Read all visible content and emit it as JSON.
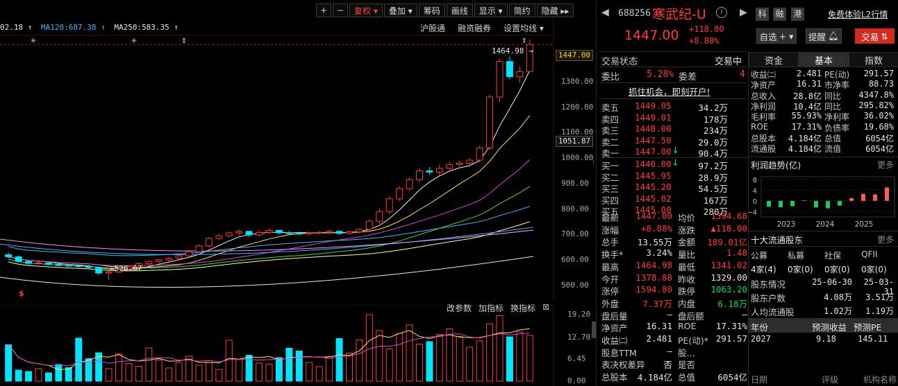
{
  "toolbar": {
    "buttons": [
      "+",
      "−",
      "复权 ▾",
      "叠加 ▾",
      "筹码",
      "画线",
      "显示 ▾",
      "简约",
      "隐藏 ▸▸"
    ]
  },
  "ma_legend": {
    "items": [
      "02.18 ↑",
      "MA120:687.38 ↑",
      "MA250:583.35 ↑"
    ]
  },
  "top_links": [
    "沪股通",
    "融资融券",
    "设置均线 ▾"
  ],
  "price_axis": [
    "1400.00",
    "1300.00",
    "1200.00",
    "1100.00",
    "1000.00",
    "900.00",
    "800.00",
    "700.00",
    "600.00",
    "500.00"
  ],
  "price_tags": {
    "current": "1447.00",
    "cursor": "1051.87",
    "high_label": "1464.98",
    "low_label": "520.67"
  },
  "vol_axis": [
    "19.20",
    "12.70",
    "6.45",
    "0.00"
  ],
  "vol_tools": [
    "改参数",
    "加指标",
    "换指标",
    "⊠"
  ],
  "stock": {
    "code": "688256",
    "name": "寒武纪-U",
    "price": "1447.00",
    "change": "+118.00",
    "change_pct": "+8.88%",
    "tags": [
      "科",
      "融",
      "港"
    ],
    "promo": "免费体验L2行情"
  },
  "actions": {
    "watch": "自选",
    "alert": "提醒",
    "trade": "交易"
  },
  "status": {
    "label": "交易状态",
    "value": "交易中"
  },
  "ratio": {
    "label": "委比",
    "value": "5.28%",
    "diff_label": "委差",
    "diff_value": "4"
  },
  "banner": "抓住机会，即刻开户!",
  "sell": [
    {
      "l": "卖五",
      "p": "1449.05",
      "v": "34.2万"
    },
    {
      "l": "卖四",
      "p": "1449.01",
      "v": "178万"
    },
    {
      "l": "卖三",
      "p": "1448.00",
      "v": "234万"
    },
    {
      "l": "卖二",
      "p": "1447.50",
      "v": "29.0万"
    },
    {
      "l": "卖一",
      "p": "1447.00",
      "v": "90.4万"
    }
  ],
  "buy": [
    {
      "l": "买一",
      "p": "1446.00",
      "v": "97.2万"
    },
    {
      "l": "买二",
      "p": "1445.95",
      "v": "28.9万"
    },
    {
      "l": "买三",
      "p": "1445.20",
      "v": "54.5万"
    },
    {
      "l": "买四",
      "p": "1445.02",
      "v": "167万"
    },
    {
      "l": "买五",
      "p": "1445.00",
      "v": "280万"
    }
  ],
  "quote": [
    [
      "最新",
      "1447.00",
      "均价",
      "1394.68"
    ],
    [
      "涨幅",
      "+8.88%",
      "涨跌",
      "▲118.00"
    ],
    [
      "总手",
      "13.55万",
      "金额",
      "189.01亿"
    ],
    [
      "换手*",
      "3.24%",
      "量比",
      "1.48"
    ],
    [
      "最高",
      "1464.98",
      "最低",
      "1341.02"
    ],
    [
      "今开",
      "1378.88",
      "昨收",
      "1329.00"
    ],
    [
      "涨停",
      "1594.80",
      "跌停",
      "1063.20"
    ],
    [
      "外盘",
      "7.37万",
      "内盘",
      "6.18万"
    ],
    [
      "盘后量",
      "—",
      "盘后额",
      "—"
    ],
    [
      "净资产",
      "16.31",
      "ROE",
      "17.31%"
    ],
    [
      "收益㈡",
      "2.481",
      "PE(动)*",
      "291.57"
    ],
    [
      "股息TTM",
      "—",
      "股…",
      ""
    ],
    [
      "表决权差异",
      "否",
      "是否",
      ""
    ],
    [
      "总股本",
      "4.184亿",
      "总值",
      "6054亿"
    ]
  ],
  "tabs": [
    "资金",
    "基本",
    "指数"
  ],
  "fund": [
    [
      "收益㈡",
      "2.481",
      "PE(动)",
      "291.57"
    ],
    [
      "净资产",
      "16.31",
      "市净率",
      "88.73"
    ],
    [
      "总收入",
      "28.8亿",
      "同比",
      "4347.8%"
    ],
    [
      "净利润",
      "10.4亿",
      "同比",
      "295.82%"
    ],
    [
      "毛利率",
      "55.93%",
      "净利率",
      "36.02%"
    ],
    [
      "ROE",
      "17.31%",
      "负债率",
      "19.68%"
    ],
    [
      "总股本",
      "4.184亿",
      "总值",
      "6054亿"
    ],
    [
      "流通股",
      "4.184亿",
      "流值",
      "6054亿"
    ]
  ],
  "profit": {
    "title": "利润趋势(亿)",
    "more": "更多",
    "yticks": [
      "8",
      "4",
      "0",
      "−4"
    ],
    "years": [
      "2023",
      "2024",
      "2025"
    ]
  },
  "holders": {
    "title": "十大流通股东",
    "more": "更多",
    "types": [
      "公募",
      "私募",
      "社保",
      "QFII"
    ],
    "counts": [
      "4家(4)",
      "0家(0)",
      "0家(0)",
      "0家(0)"
    ],
    "rows": [
      [
        "股东情况",
        "25-06-30",
        "25-03-31"
      ],
      [
        "股东户数",
        "4.08万",
        "3.51万"
      ],
      [
        "人均流通股",
        "1.02万",
        "1.19万"
      ]
    ]
  },
  "forecast": {
    "headers": [
      "年份",
      "预测收益",
      "预测PE"
    ],
    "rows": [
      [
        "2027",
        "9.18",
        "145.11"
      ]
    ],
    "footer": [
      "日期",
      "评级",
      "机构名称"
    ]
  },
  "chart_data": {
    "type": "candlestick",
    "ylim": [
      450,
      1480
    ],
    "candles": [
      [
        620,
        628,
        605,
        612
      ],
      [
        612,
        618,
        588,
        594
      ],
      [
        594,
        600,
        578,
        586
      ],
      [
        586,
        592,
        580,
        588
      ],
      [
        588,
        594,
        578,
        582
      ],
      [
        582,
        588,
        574,
        578
      ],
      [
        578,
        584,
        572,
        576
      ],
      [
        576,
        582,
        570,
        574
      ],
      [
        574,
        580,
        566,
        570
      ],
      [
        570,
        576,
        540,
        548
      ],
      [
        548,
        558,
        521,
        552
      ],
      [
        552,
        568,
        548,
        564
      ],
      [
        564,
        578,
        556,
        572
      ],
      [
        572,
        590,
        566,
        585
      ],
      [
        585,
        598,
        578,
        594
      ],
      [
        594,
        604,
        588,
        600
      ],
      [
        600,
        612,
        594,
        606
      ],
      [
        606,
        620,
        600,
        616
      ],
      [
        616,
        640,
        610,
        632
      ],
      [
        632,
        660,
        628,
        655
      ],
      [
        655,
        690,
        648,
        684
      ],
      [
        684,
        702,
        676,
        695
      ],
      [
        695,
        712,
        688,
        706
      ],
      [
        706,
        720,
        694,
        712
      ],
      [
        712,
        714,
        690,
        698
      ],
      [
        698,
        716,
        690,
        708
      ],
      [
        708,
        722,
        700,
        716
      ],
      [
        716,
        718,
        700,
        706
      ],
      [
        706,
        714,
        700,
        704
      ],
      [
        704,
        710,
        698,
        702
      ],
      [
        702,
        712,
        696,
        706
      ],
      [
        706,
        714,
        700,
        708
      ],
      [
        708,
        720,
        700,
        712
      ],
      [
        712,
        716,
        698,
        704
      ],
      [
        704,
        716,
        698,
        710
      ],
      [
        710,
        724,
        706,
        720
      ],
      [
        720,
        760,
        716,
        752
      ],
      [
        752,
        800,
        740,
        790
      ],
      [
        790,
        850,
        780,
        840
      ],
      [
        840,
        890,
        830,
        880
      ],
      [
        880,
        925,
        870,
        915
      ],
      [
        915,
        960,
        905,
        950
      ],
      [
        950,
        965,
        935,
        945
      ],
      [
        945,
        975,
        930,
        960
      ],
      [
        960,
        985,
        950,
        975
      ],
      [
        975,
        990,
        965,
        980
      ],
      [
        980,
        1000,
        965,
        992
      ],
      [
        992,
        1050,
        985,
        1040
      ],
      [
        1040,
        1250,
        1030,
        1240
      ],
      [
        1240,
        1390,
        1220,
        1380
      ],
      [
        1380,
        1400,
        1310,
        1320
      ],
      [
        1320,
        1360,
        1295,
        1340
      ],
      [
        1340,
        1464.98,
        1341.02,
        1447
      ]
    ],
    "volume": [
      10.5,
      3.2,
      2.8,
      3.6,
      2.4,
      4.8,
      3.9,
      12.4,
      6.5,
      8.2,
      3.6,
      7.8,
      5.1,
      4.3,
      9.6,
      6.1,
      3.8,
      5.4,
      7.2,
      4.6,
      5.9,
      3.4,
      11.8,
      6.2,
      7.5,
      5.2,
      4.9,
      6.8,
      9.5,
      8.7,
      5.4,
      4.2,
      7.1,
      12.3,
      8.1,
      11.9,
      19.2,
      14.6,
      9.3,
      13.8,
      16.2,
      10.7,
      11.4,
      13.5,
      15.1,
      12.9,
      9.8,
      11.6,
      16.5,
      18.9,
      12.8,
      14.2,
      13.2
    ]
  }
}
